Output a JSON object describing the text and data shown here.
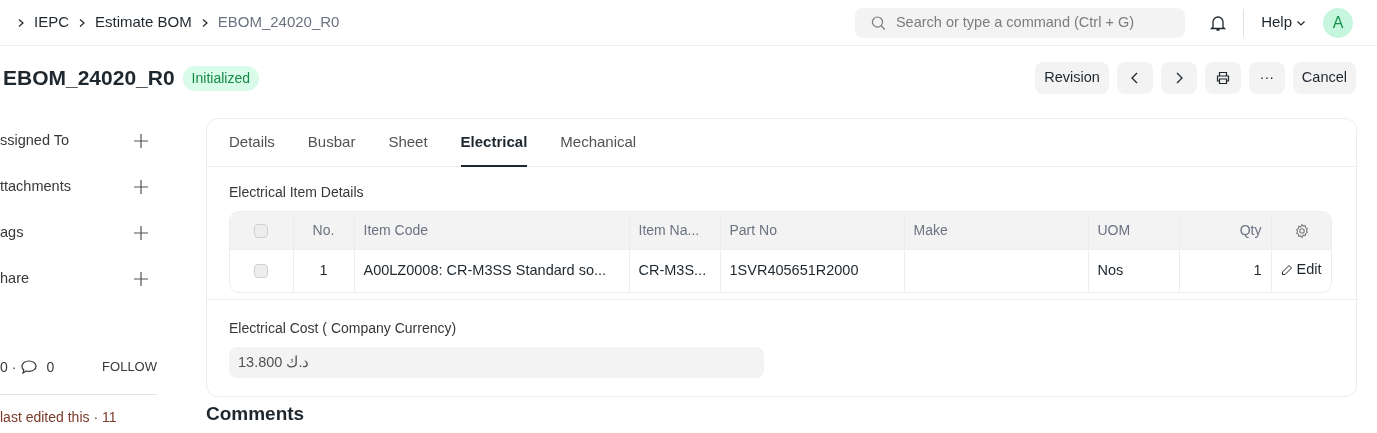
{
  "breadcrumbs": [
    {
      "label": "IEPC",
      "current": false
    },
    {
      "label": "Estimate BOM",
      "current": false
    },
    {
      "label": "EBOM_24020_R0",
      "current": true
    }
  ],
  "search": {
    "placeholder": "Search or type a command (Ctrl + G)"
  },
  "help": {
    "label": "Help"
  },
  "avatar": {
    "initial": "A"
  },
  "title": "EBOM_24020_R0",
  "status": "Initialized",
  "actions": [
    {
      "kind": "text",
      "label": "Revision"
    },
    {
      "kind": "prev"
    },
    {
      "kind": "next"
    },
    {
      "kind": "print"
    },
    {
      "kind": "more",
      "label": "···"
    },
    {
      "kind": "text",
      "label": "Cancel"
    }
  ],
  "sidebar": {
    "items": [
      "ssigned To",
      "ttachments",
      "ags",
      "hare"
    ],
    "likes": "0",
    "separator": "·",
    "comments": "0",
    "follow": "FOLLOW",
    "activity": "last edited this · 11"
  },
  "tabs": [
    {
      "label": "Details",
      "selected": false
    },
    {
      "label": "Busbar",
      "selected": false
    },
    {
      "label": "Sheet",
      "selected": false
    },
    {
      "label": "Electrical",
      "selected": true
    },
    {
      "label": "Mechanical",
      "selected": false
    }
  ],
  "section_label": "Electrical Item Details",
  "table": {
    "all_checked": false,
    "columns": [
      "No.",
      "Item Code",
      "Item Na...",
      "Part No",
      "Make",
      "UOM",
      "Qty"
    ],
    "rows": [
      {
        "checked": false,
        "cells": [
          "1",
          "A00LZ0008: CR-M3SS Standard so...",
          "CR-M3S...",
          "1SVR405651R2000",
          "",
          "Nos",
          "1"
        ],
        "action": "Edit"
      }
    ]
  },
  "cost": {
    "label": "Electrical Cost ( Company Currency)",
    "value": "13.800 د.ك"
  },
  "comments_heading": "Comments"
}
